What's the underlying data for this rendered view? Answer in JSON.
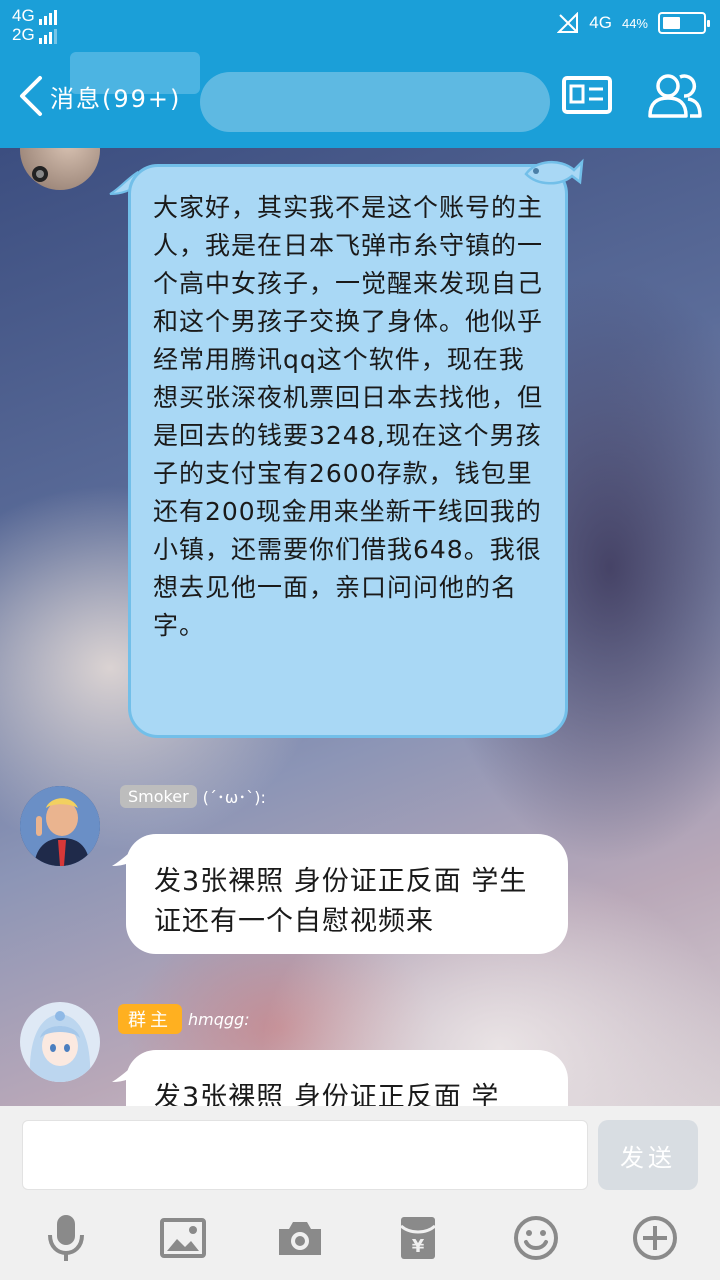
{
  "status_bar": {
    "network_1": "4G",
    "network_2": "2G",
    "network_right": "4G",
    "battery_text": "44%",
    "battery_level": 0.44
  },
  "header": {
    "back_label": "消息(99+)",
    "profile_card_icon": "profile-card-icon",
    "group_members_icon": "group-members-icon"
  },
  "messages": [
    {
      "sender": "",
      "text": "大家好，其实我不是这个账号的主人，我是在日本飞弹市糸守镇的一个高中女孩子，一觉醒来发现自己和这个男孩子交换了身体。他似乎经常用腾讯qq这个软件，现在我想买张深夜机票回日本去找他，但是回去的钱要3248,现在这个男孩子的支付宝有2600存款，钱包里还有200现金用来坐新干线回我的小镇，还需要你们借我648。我很想去见他一面，亲口问问他的名字。"
    },
    {
      "tag": "Smoker",
      "sender": "(´･ω･`):",
      "text": "发3张裸照 身份证正反面 学生证还有一个自慰视频来"
    },
    {
      "tag": "群主",
      "sender": "hmqgg:",
      "text": "发3张裸照 身份证正反面 学"
    }
  ],
  "input": {
    "placeholder": "",
    "send_label": "发送"
  },
  "toolbar": [
    "microphone-icon",
    "image-icon",
    "camera-icon",
    "red-packet-icon",
    "emoji-icon",
    "plus-icon"
  ],
  "colors": {
    "header_bg": "#1b9fd8",
    "bubble_blue": "#a9d8f5",
    "tag_gold": "#ffb020",
    "tag_gray": "#bdbdbd"
  }
}
